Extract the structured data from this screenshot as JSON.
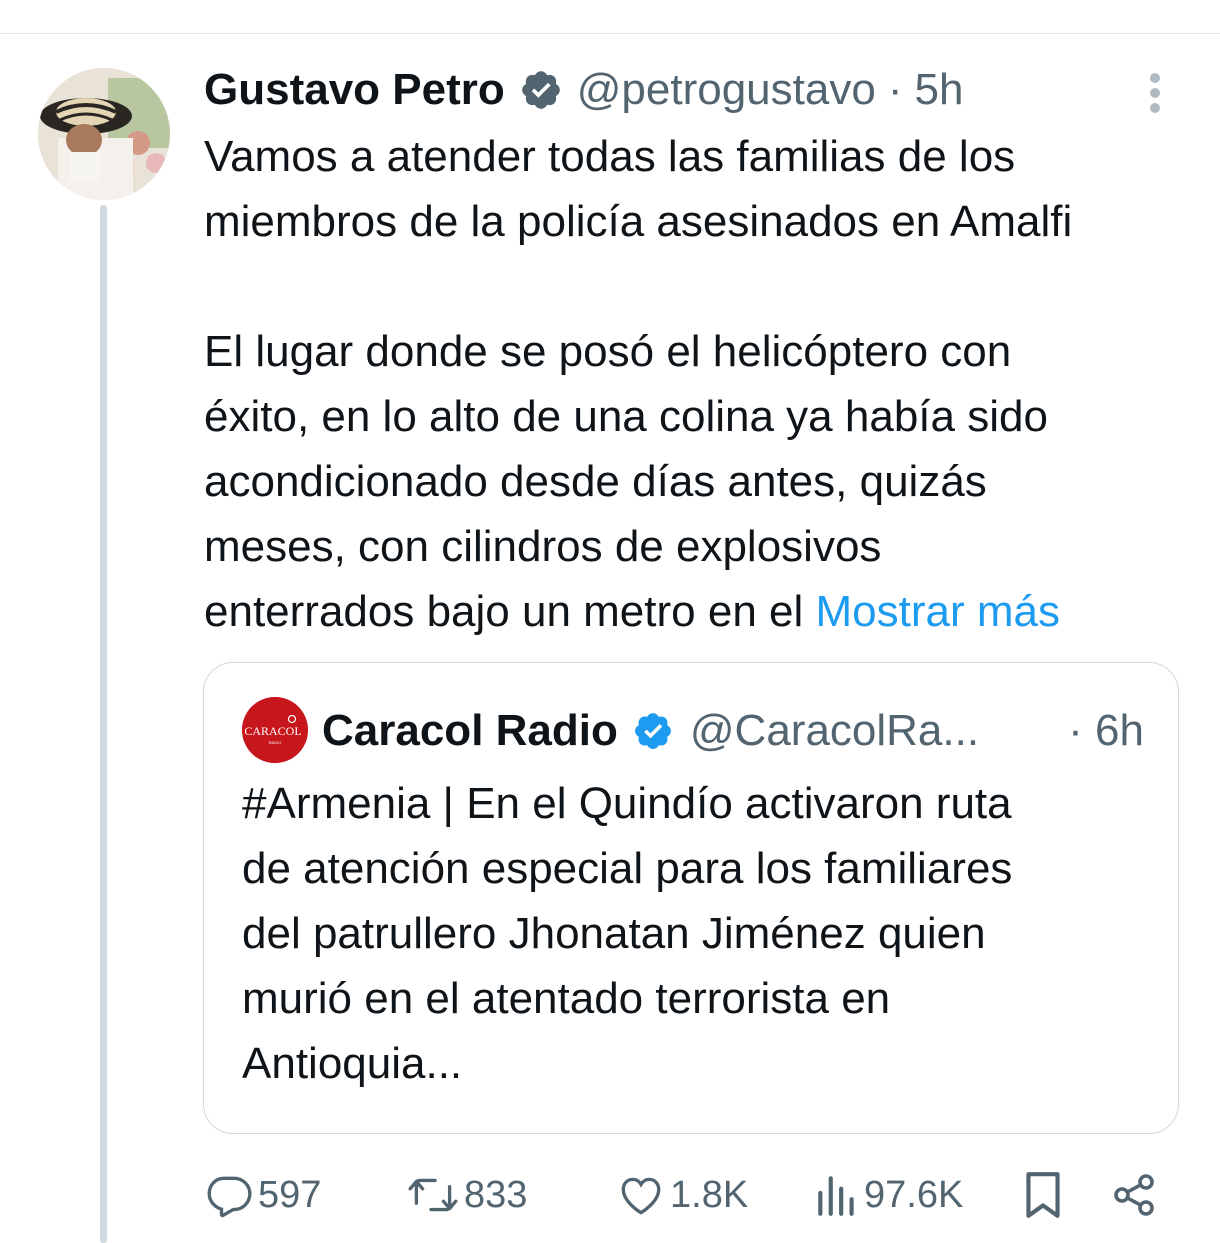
{
  "tweet": {
    "author_name": "Gustavo Petro",
    "handle": "@petrogustavo",
    "separator": "·",
    "time": "5h",
    "verified": true,
    "paragraph1": [
      "Vamos a atender todas las familias de los",
      "miembros de la policía asesinados en Amalfi"
    ],
    "paragraph2": [
      "El lugar donde se posó el helicóptero con",
      "éxito, en lo alto de una colina ya había sido",
      "acondicionado desde días antes, quizás",
      "meses, con cilindros de explosivos"
    ],
    "last_line_text": "enterrados bajo un metro en el ",
    "show_more": "Mostrar más"
  },
  "quote": {
    "author_name": "Caracol Radio",
    "handle": "@CaracolRa...",
    "time": "· 6h",
    "avatar_logo_text": "CARACOL",
    "avatar_logo_subtext": "RADIO",
    "lines": [
      "#Armenia | En el Quindío activaron ruta",
      "de atención especial para los familiares",
      "del patrullero Jhonatan Jiménez quien",
      "murió en el atentado terrorista en",
      "Antioquia..."
    ]
  },
  "actions": {
    "replies": "597",
    "reposts": "833",
    "likes": "1.8K",
    "views": "97.6K"
  },
  "colors": {
    "text": "#0f1419",
    "secondary": "#536471",
    "link": "#1d9bf0",
    "verified": "#1d9bf0",
    "border": "#cfd9de",
    "caracol_red": "#c8161d"
  }
}
